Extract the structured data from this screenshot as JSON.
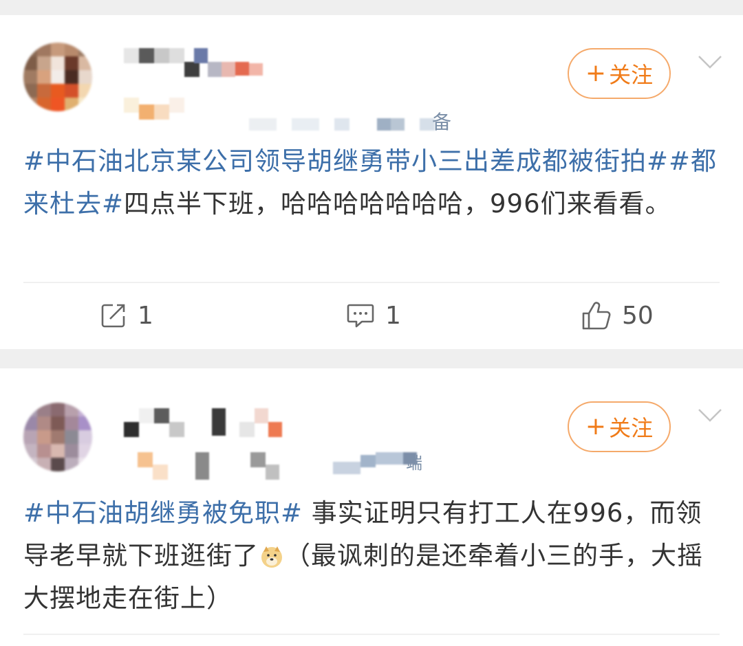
{
  "posts": [
    {
      "follow_label": "关注",
      "follow_plus": "+",
      "meta_suffix": "备",
      "text_parts": {
        "tag1": "#中石油北京某公司领导胡继勇带小三出差成都被街拍#",
        "tag2": "#都来杜去#",
        "body": "四点半下班，哈哈哈哈哈哈哈，996们来看看。"
      },
      "actions": {
        "repost_count": "1",
        "comment_count": "1",
        "like_count": "50"
      }
    },
    {
      "follow_label": "关注",
      "follow_plus": "+",
      "meta_suffix": "端",
      "text_parts": {
        "tag1": "#中石油胡继勇被免职#",
        "body1": " 事实证明只有打工人在996，而领导老早就下班逛街了",
        "body2": "（最讽刺的是还牵着小三的手，大摇大摆地走在街上）"
      }
    }
  ],
  "colors": {
    "accent_orange": "#f07b18",
    "tag_blue": "#3d6fa9",
    "text_dark": "#333333"
  },
  "icons": [
    "repost-icon",
    "comment-icon",
    "like-icon",
    "chevron-down-icon",
    "doge-emoji-icon"
  ]
}
